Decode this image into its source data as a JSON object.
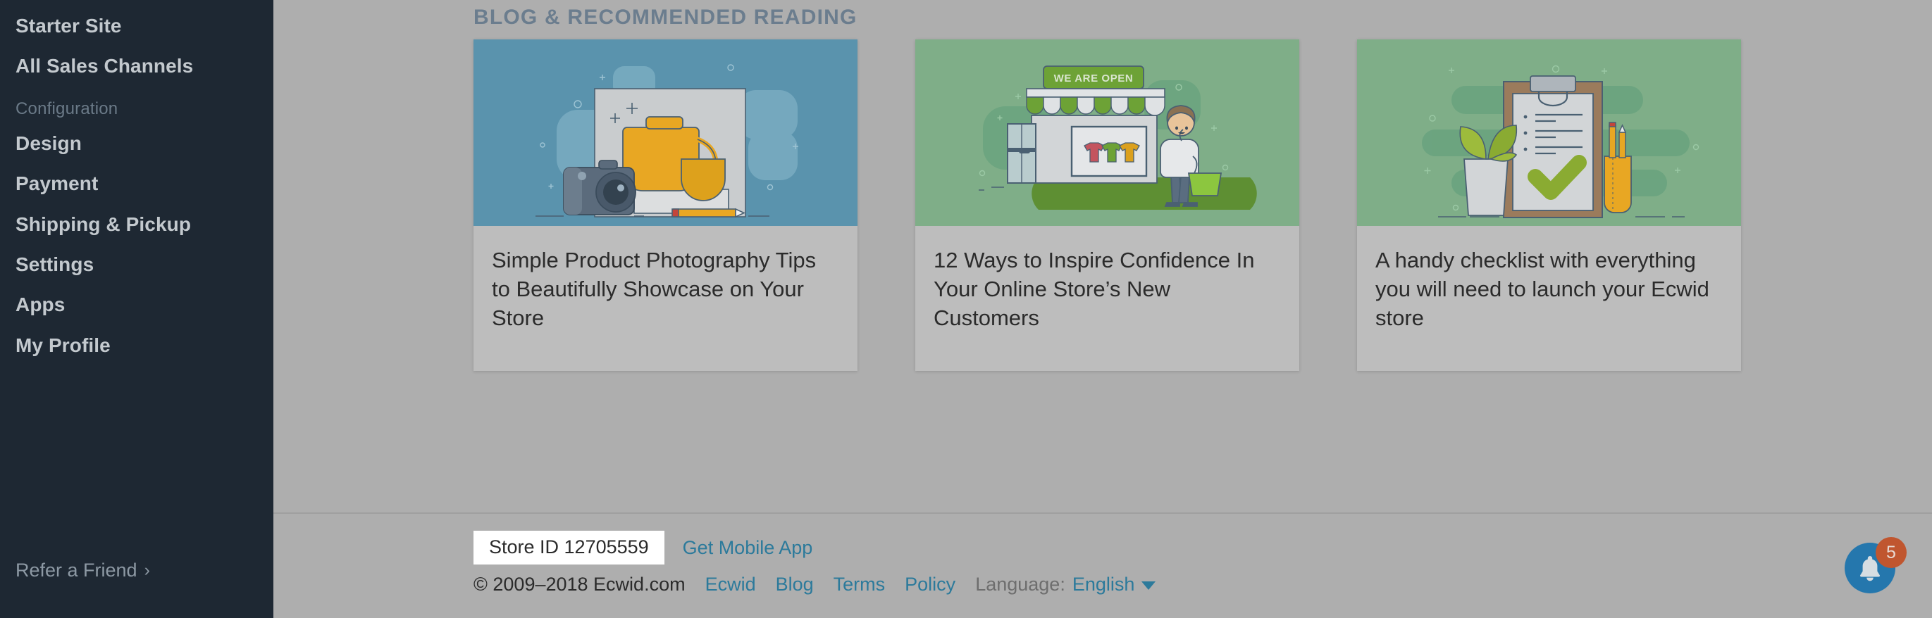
{
  "sidebar": {
    "items": [
      {
        "label": "Starter Site",
        "type": "link"
      },
      {
        "label": "All Sales Channels",
        "type": "link"
      },
      {
        "label": "Configuration",
        "type": "section"
      },
      {
        "label": "Design",
        "type": "link"
      },
      {
        "label": "Payment",
        "type": "link"
      },
      {
        "label": "Shipping & Pickup",
        "type": "link"
      },
      {
        "label": "Settings",
        "type": "link"
      },
      {
        "label": "Apps",
        "type": "link"
      },
      {
        "label": "My Profile",
        "type": "link"
      }
    ],
    "refer": {
      "label": "Refer a Friend",
      "chevron": "›"
    }
  },
  "main": {
    "section_title": "BLOG & RECOMMENDED READING",
    "cards": [
      {
        "title": "Simple Product Photography Tips to Beautifully Showcase on Your Store",
        "image_name": "product-photography-illustration",
        "bg": "#5a93ad"
      },
      {
        "title": "12 Ways to Inspire Confidence In Your Online Store’s New Customers",
        "image_name": "storefront-illustration",
        "bg": "#7fae88",
        "sign_text": "WE ARE OPEN"
      },
      {
        "title": "A handy checklist with everything you will need to launch your Ecwid store",
        "image_name": "checklist-clipboard-illustration",
        "bg": "#7fae88"
      }
    ]
  },
  "footer": {
    "store_id": "Store ID 12705559",
    "get_mobile_app": "Get Mobile App",
    "copyright": "© 2009–2018 Ecwid.com",
    "links": [
      "Ecwid",
      "Blog",
      "Terms",
      "Policy"
    ],
    "language_label": "Language:",
    "language_value": "English"
  },
  "notifications": {
    "count": "5",
    "icon": "bell-icon"
  },
  "colors": {
    "sidebar_bg": "#1e2833",
    "page_bg": "#aeaeae",
    "card_bg": "#bdbdbd",
    "link": "#2c7a9b",
    "heading": "#6b7d8e",
    "bell": "#2577ad",
    "badge": "#c0562f"
  }
}
